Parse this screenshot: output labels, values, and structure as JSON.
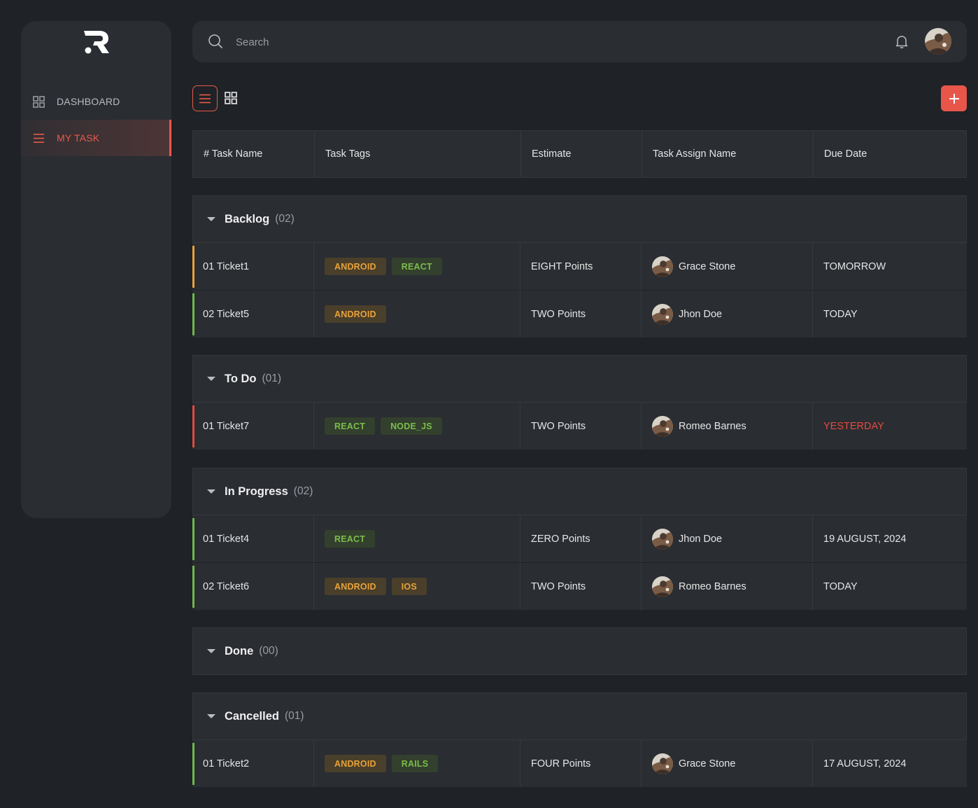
{
  "sidebar": {
    "items": [
      {
        "label": "DASHBOARD",
        "icon": "grid-icon"
      },
      {
        "label": "MY TASK",
        "icon": "menu-icon",
        "active": true
      }
    ]
  },
  "search": {
    "placeholder": "Search"
  },
  "table": {
    "headers": [
      "# Task Name",
      "Task Tags",
      "Estimate",
      "Task Assign Name",
      "Due Date"
    ]
  },
  "groups": [
    {
      "title": "Backlog",
      "count": "(02)",
      "rows": [
        {
          "name": "01 Ticket1",
          "bar": "#e8a23a",
          "tags": [
            {
              "label": "ANDROID",
              "style": "orange"
            },
            {
              "label": "REACT",
              "style": "green"
            }
          ],
          "estimate": "EIGHT Points",
          "assignee": "Grace Stone",
          "due": "TOMORROW",
          "due_color": "normal"
        },
        {
          "name": "02 Ticket5",
          "bar": "#6fb84a",
          "tags": [
            {
              "label": "ANDROID",
              "style": "orange"
            }
          ],
          "estimate": "TWO Points",
          "assignee": "Jhon Doe",
          "due": "TODAY",
          "due_color": "normal"
        }
      ]
    },
    {
      "title": "To Do",
      "count": "(01)",
      "rows": [
        {
          "name": "01 Ticket7",
          "bar": "#e24b3f",
          "tags": [
            {
              "label": "REACT",
              "style": "green"
            },
            {
              "label": "NODE_JS",
              "style": "green"
            }
          ],
          "estimate": "TWO Points",
          "assignee": "Romeo Barnes",
          "due": "YESTERDAY",
          "due_color": "red"
        }
      ]
    },
    {
      "title": "In Progress",
      "count": "(02)",
      "rows": [
        {
          "name": "01 Ticket4",
          "bar": "#6fb84a",
          "tags": [
            {
              "label": "REACT",
              "style": "green"
            }
          ],
          "estimate": "ZERO Points",
          "assignee": "Jhon Doe",
          "due": "19 AUGUST, 2024",
          "due_color": "normal"
        },
        {
          "name": "02 Ticket6",
          "bar": "#6fb84a",
          "tags": [
            {
              "label": "ANDROID",
              "style": "orange"
            },
            {
              "label": "IOS",
              "style": "orange"
            }
          ],
          "estimate": "TWO Points",
          "assignee": "Romeo Barnes",
          "due": "TODAY",
          "due_color": "normal"
        }
      ]
    },
    {
      "title": "Done",
      "count": "(00)",
      "rows": []
    },
    {
      "title": "Cancelled",
      "count": "(01)",
      "rows": [
        {
          "name": "01 Ticket2",
          "bar": "#6fb84a",
          "tags": [
            {
              "label": "ANDROID",
              "style": "orange"
            },
            {
              "label": "RAILS",
              "style": "green"
            }
          ],
          "estimate": "FOUR Points",
          "assignee": "Grace Stone",
          "due": "17 AUGUST, 2024",
          "due_color": "normal"
        }
      ]
    }
  ],
  "colors": {
    "accent": "#e85a4a",
    "background": "#1f2226",
    "panel": "#2a2d32"
  }
}
